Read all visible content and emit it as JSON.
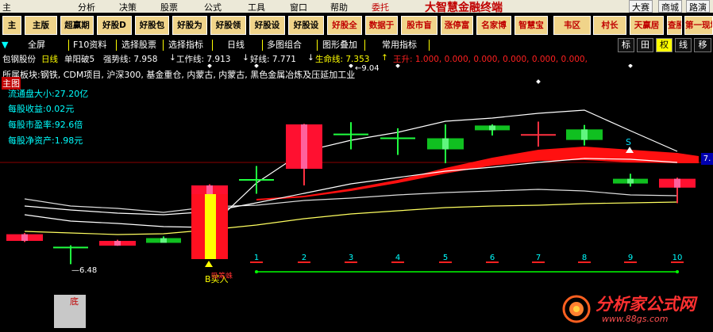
{
  "menu": {
    "items": [
      "主",
      "分析",
      "决策",
      "股票",
      "公式",
      "工具",
      "窗口",
      "帮助"
    ],
    "entrust": "委托",
    "brand": "大智慧金融终端",
    "right_items": [
      "大赛",
      "商城",
      "路演"
    ]
  },
  "toolbar_buttons": [
    "主",
    "主版",
    "超赢期",
    "好股D",
    "好股包",
    "好股为",
    "好股领",
    "好股设",
    "好股设",
    "好股全",
    "数据于",
    "股市盲",
    "涨停富",
    "名家博",
    "智慧宝",
    "韦区",
    "村长",
    "天赢居",
    "查股网",
    "第一现场"
  ],
  "toolrow": {
    "items": [
      "全屏",
      "F10资料",
      "选择股票",
      "选择指标",
      "日线",
      "多图组合",
      "图形叠加",
      "常用指标"
    ],
    "right_buttons": [
      "标",
      "田",
      "权",
      "线",
      "移"
    ]
  },
  "inforow": {
    "stock": "包钢股份",
    "period": "日线",
    "indicator": "单阳破5",
    "strong": "强势线: 7.958",
    "work": "工作线: 7.913",
    "good": "好线: 7.771",
    "life": "生命线: 7.353",
    "wangsheng": "王升: 1.000, 0.000, 0.000, 0.000, 0.000, 0.000,"
  },
  "chart_labels": {
    "board": "所属板块:钢铁, CDM项目, 沪深300, 基金重仓, 内蒙古, 内蒙古, 黑色金属冶炼及压延加工业",
    "main": "主图",
    "fundamentals": [
      "流通盘大小:27.20亿",
      "每股收益:0.02元",
      "每股市盈率:92.6倍",
      "每股净资产:1.98元"
    ],
    "high_label": "9.04",
    "low_label": "6.48",
    "buy_label": "B买入",
    "buy_label2": "吸筹蛛",
    "s_label": "S",
    "price_tag": "7.",
    "bottom_label": "底",
    "counts": [
      "1",
      "2",
      "3",
      "4",
      "5",
      "6",
      "7",
      "8",
      "9",
      "10"
    ]
  },
  "watermark": {
    "text": "分析家公式网",
    "url": "www.88gs.com"
  },
  "chart_data": {
    "type": "candlestick",
    "candles": [
      {
        "o": 6.9,
        "c": 7.02,
        "h": 7.04,
        "l": 6.88
      },
      {
        "o": 6.78,
        "c": 6.74,
        "h": 6.82,
        "l": 6.48
      },
      {
        "o": 6.83,
        "c": 6.9,
        "h": 6.92,
        "l": 6.81
      },
      {
        "o": 6.95,
        "c": 6.93,
        "h": 6.98,
        "l": 6.88
      },
      {
        "o": 6.85,
        "c": 7.9,
        "h": 7.92,
        "l": 6.85
      },
      {
        "o": 8.0,
        "c": 7.98,
        "h": 8.25,
        "l": 7.75
      },
      {
        "o": 8.2,
        "c": 9.0,
        "h": 9.01,
        "l": 7.9
      },
      {
        "o": 8.82,
        "c": 8.8,
        "h": 9.04,
        "l": 8.55
      },
      {
        "o": 8.75,
        "c": 8.73,
        "h": 8.93,
        "l": 8.45
      },
      {
        "o": 8.75,
        "c": 8.55,
        "h": 9.0,
        "l": 8.3
      },
      {
        "o": 8.98,
        "c": 8.9,
        "h": 9.0,
        "l": 8.8
      },
      {
        "o": 8.8,
        "c": 8.81,
        "h": 9.05,
        "l": 8.6
      },
      {
        "o": 8.91,
        "c": 8.72,
        "h": 8.99,
        "l": 8.62
      },
      {
        "o": 8.02,
        "c": 8.0,
        "h": 8.11,
        "l": 7.88
      },
      {
        "o": 7.86,
        "c": 8.02,
        "h": 8.04,
        "l": 7.58
      }
    ]
  }
}
